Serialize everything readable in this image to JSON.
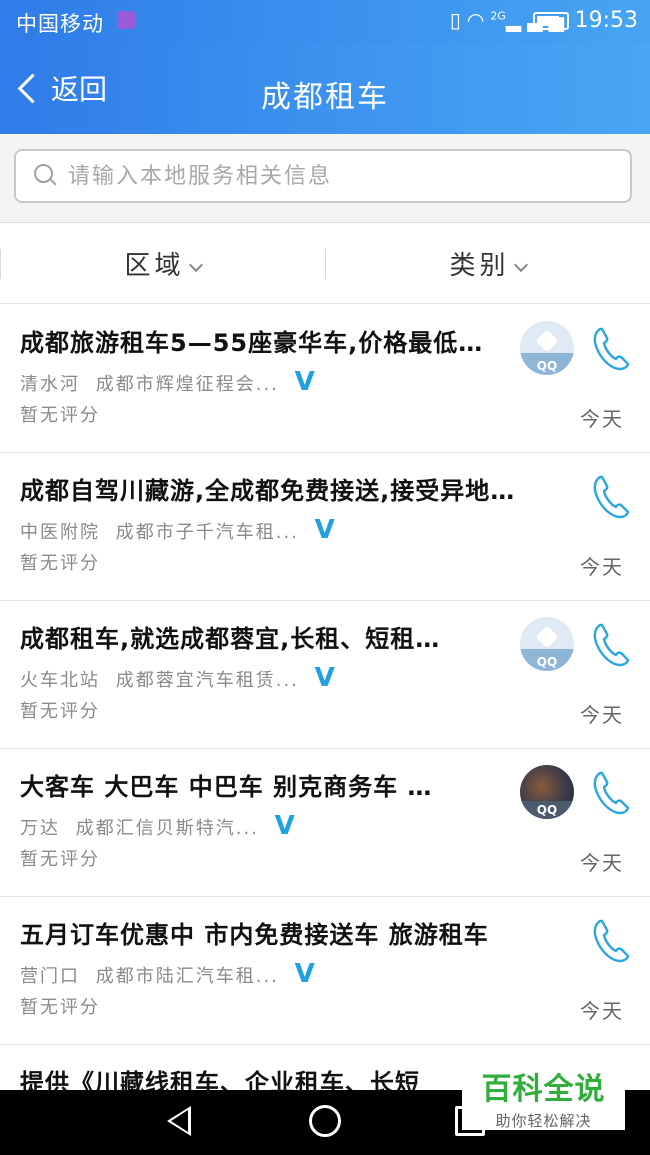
{
  "status_bar": {
    "carrier": "中国移动",
    "network": "2G",
    "time": "19:53"
  },
  "header": {
    "back_label": "返回",
    "title": "成都租车"
  },
  "search": {
    "placeholder": "请输入本地服务相关信息",
    "value": ""
  },
  "filters": [
    {
      "label": "区域"
    },
    {
      "label": "类别"
    }
  ],
  "listings": [
    {
      "title": "成都旅游租车5—55座豪华车,价格最低…",
      "area": "清水河",
      "company": "成都市辉煌征程会...",
      "verified": "V",
      "rating": "暂无评分",
      "date": "今天",
      "avatar": "qq-avatar",
      "avatar_label": "QQ"
    },
    {
      "title": "成都自驾川藏游,全成都免费接送,接受异地…",
      "area": "中医附院",
      "company": "成都市子千汽车租...",
      "verified": "V",
      "rating": "暂无评分",
      "date": "今天",
      "avatar": "",
      "avatar_label": ""
    },
    {
      "title": "成都租车,就选成都蓉宜,长租、短租…",
      "area": "火车北站",
      "company": "成都蓉宜汽车租赁...",
      "verified": "V",
      "rating": "暂无评分",
      "date": "今天",
      "avatar": "qq-avatar",
      "avatar_label": "QQ"
    },
    {
      "title": "大客车  大巴车  中巴车  别克商务车  …",
      "area": "万达",
      "company": "成都汇信贝斯特汽...",
      "verified": "V",
      "rating": "暂无评分",
      "date": "今天",
      "avatar": "photo-avatar",
      "avatar_label": "QQ"
    },
    {
      "title": "五月订车优惠中  市内免费接送车  旅游租车",
      "area": "营门口",
      "company": "成都市陆汇汽车租...",
      "verified": "V",
      "rating": "暂无评分",
      "date": "今天",
      "avatar": "",
      "avatar_label": ""
    }
  ],
  "partial_listing": {
    "title": "提供《川藏线租车、企业租车、长短"
  },
  "watermark": {
    "brand": "百科全说",
    "tagline": "助你轻松解决"
  },
  "colors": {
    "header_blue": "#3a8ff0",
    "verified_blue": "#1fa0e0",
    "phone_icon": "#2aa6e0",
    "watermark_green": "#2fae3b"
  }
}
